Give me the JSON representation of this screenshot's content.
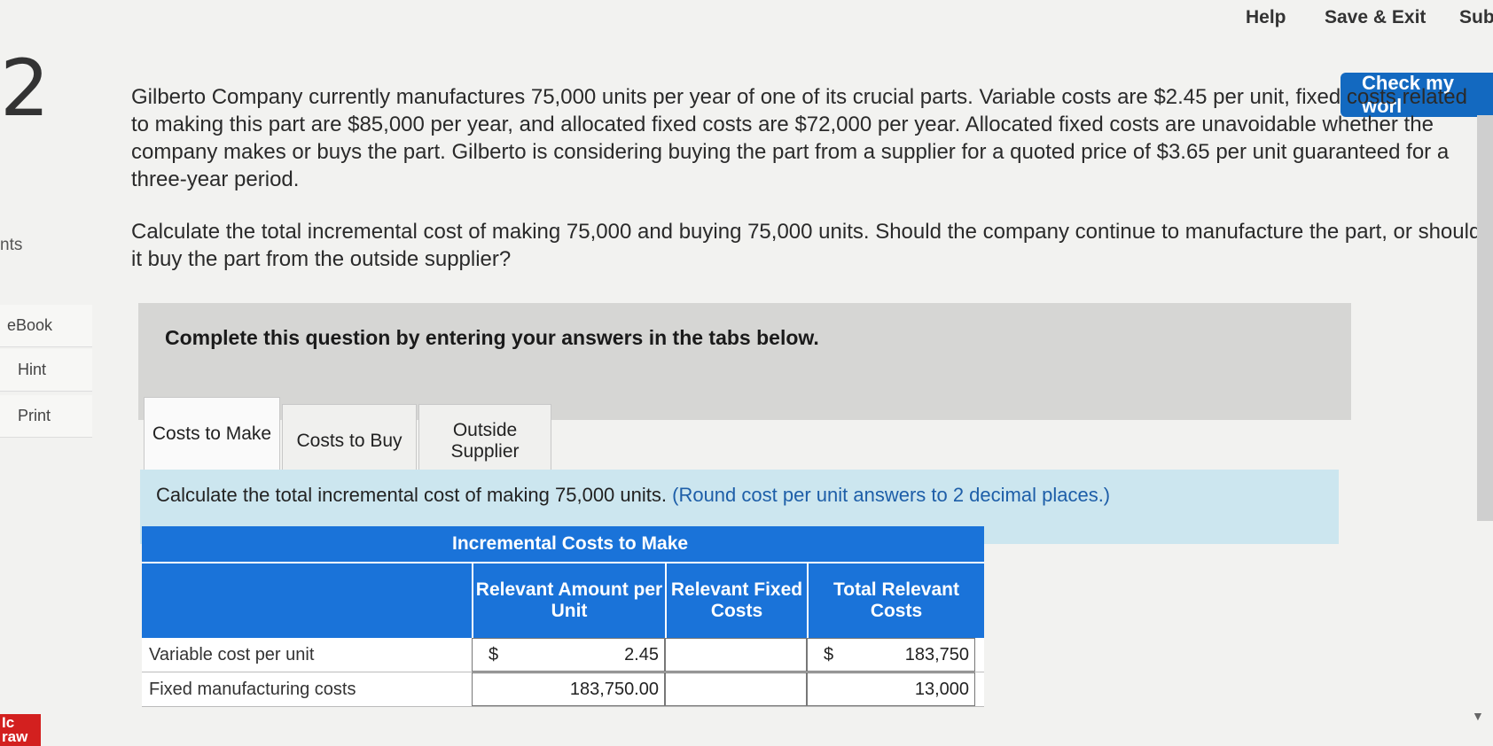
{
  "header": {
    "help_label": "Help",
    "save_exit_label": "Save & Exit",
    "submit_label": "Sub",
    "check_work_label": "Check my worl"
  },
  "sidebar": {
    "question_number": "2",
    "points_label": "nts",
    "items": [
      {
        "label": "eBook"
      },
      {
        "label": "Hint"
      },
      {
        "label": "Print"
      }
    ],
    "logo_text": "Ic\nraw"
  },
  "question": {
    "paragraph1": "Gilberto Company currently manufactures 75,000 units per year of one of its crucial parts. Variable costs are $2.45 per unit, fixed costs related to making this part are $85,000 per year, and allocated fixed costs are $72,000 per year. Allocated fixed costs are unavoidable whether the company makes or buys the part. Gilberto is considering buying the part from a supplier for a quoted price of $3.65 per unit guaranteed for a three-year period.",
    "paragraph2": "Calculate the total incremental cost of making 75,000 and buying 75,000 units. Should the company continue to manufacture the part, or should it buy the part from the outside supplier?"
  },
  "instructions": {
    "text": "Complete this question by entering your answers in the tabs below."
  },
  "tabs": [
    {
      "label": "Costs to Make"
    },
    {
      "label": "Costs to Buy"
    },
    {
      "label": "Outside Supplier"
    }
  ],
  "prompt": {
    "text": "Calculate the total incremental cost of making 75,000 units.",
    "note": "(Round cost per unit answers to 2 decimal places.)"
  },
  "table": {
    "title": "Incremental Costs to Make",
    "columns": [
      "Relevant Amount per Unit",
      "Relevant Fixed Costs",
      "Total Relevant Costs"
    ],
    "rows": [
      {
        "label": "Variable cost per unit",
        "currency1": "$",
        "amount_per_unit": "2.45",
        "fixed_costs": "",
        "currency3": "$",
        "total": "183,750"
      },
      {
        "label": "Fixed manufacturing costs",
        "currency1": "",
        "amount_per_unit": "183,750.00",
        "fixed_costs": "",
        "currency3": "",
        "total": "13,000"
      }
    ]
  }
}
